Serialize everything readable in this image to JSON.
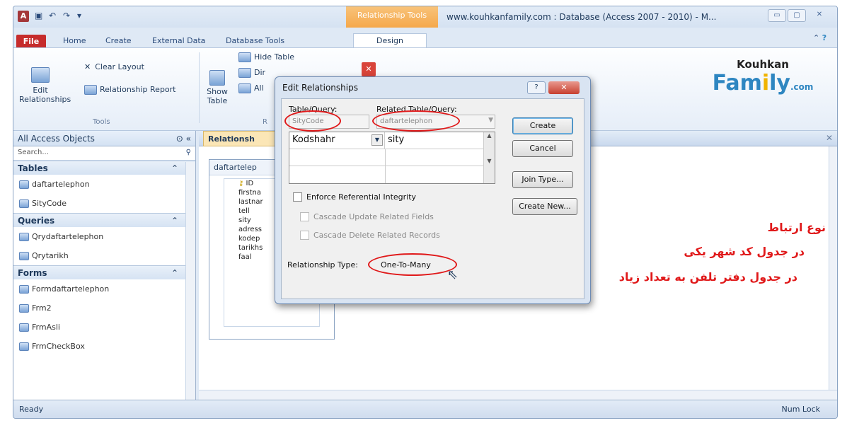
{
  "window": {
    "title": "www.kouhkanfamily.com : Database (Access 2007 - 2010) - M...",
    "contextual_tab": "Relationship Tools"
  },
  "tabs": [
    "File",
    "Home",
    "Create",
    "External Data",
    "Database Tools",
    "Design"
  ],
  "ribbon": {
    "edit_relationships": "Edit\nRelationships",
    "clear_layout": "Clear Layout",
    "relationship_report": "Relationship Report",
    "tools_group": "Tools",
    "show_table": "Show\nTable",
    "hide_table": "Hide Table",
    "direct": "Dir",
    "all": "All",
    "rel_group": "R"
  },
  "logo": {
    "line1": "Kouhkan",
    "line2a": "Fam",
    "line2b": "i",
    "line2c": "ly",
    "line3": ".com"
  },
  "nav": {
    "header": "All Access Objects",
    "search_placeholder": "Search...",
    "categories": [
      {
        "name": "Tables",
        "items": [
          "daftartelephon",
          "SityCode"
        ]
      },
      {
        "name": "Queries",
        "items": [
          "Qrydaftartelephon",
          "Qrytarikh"
        ]
      },
      {
        "name": "Forms",
        "items": [
          "Formdaftartelephon",
          "Frm2",
          "FrmAsli",
          "FrmCheckBox"
        ]
      }
    ]
  },
  "document": {
    "tab": "Relationsh",
    "table_title": "daftartelep",
    "fields": [
      "ID",
      "firstna",
      "lastnar",
      "tell",
      "sity",
      "adress",
      "kodep",
      "tarikhs",
      "faal"
    ]
  },
  "dialog": {
    "title": "Edit Relationships",
    "table_query_label": "Table/Query:",
    "related_label": "Related Table/Query:",
    "table_value": "SityCode",
    "related_value": "daftartelephon",
    "field_left": "Kodshahr",
    "field_right": "sity",
    "enforce": "Enforce Referential Integrity",
    "cascade_update": "Cascade Update Related Fields",
    "cascade_delete": "Cascade Delete Related Records",
    "rel_type_label": "Relationship Type:",
    "rel_type_value": "One-To-Many",
    "buttons": {
      "create": "Create",
      "cancel": "Cancel",
      "join": "Join Type...",
      "create_new": "Create New..."
    }
  },
  "annotation": {
    "line1": "نوع ارتباط",
    "line2": "در جدول کد شهر یکی",
    "line3": "در جدول دفتر تلفن به تعداد زیاد"
  },
  "status": {
    "left": "Ready",
    "right": "Num Lock"
  }
}
